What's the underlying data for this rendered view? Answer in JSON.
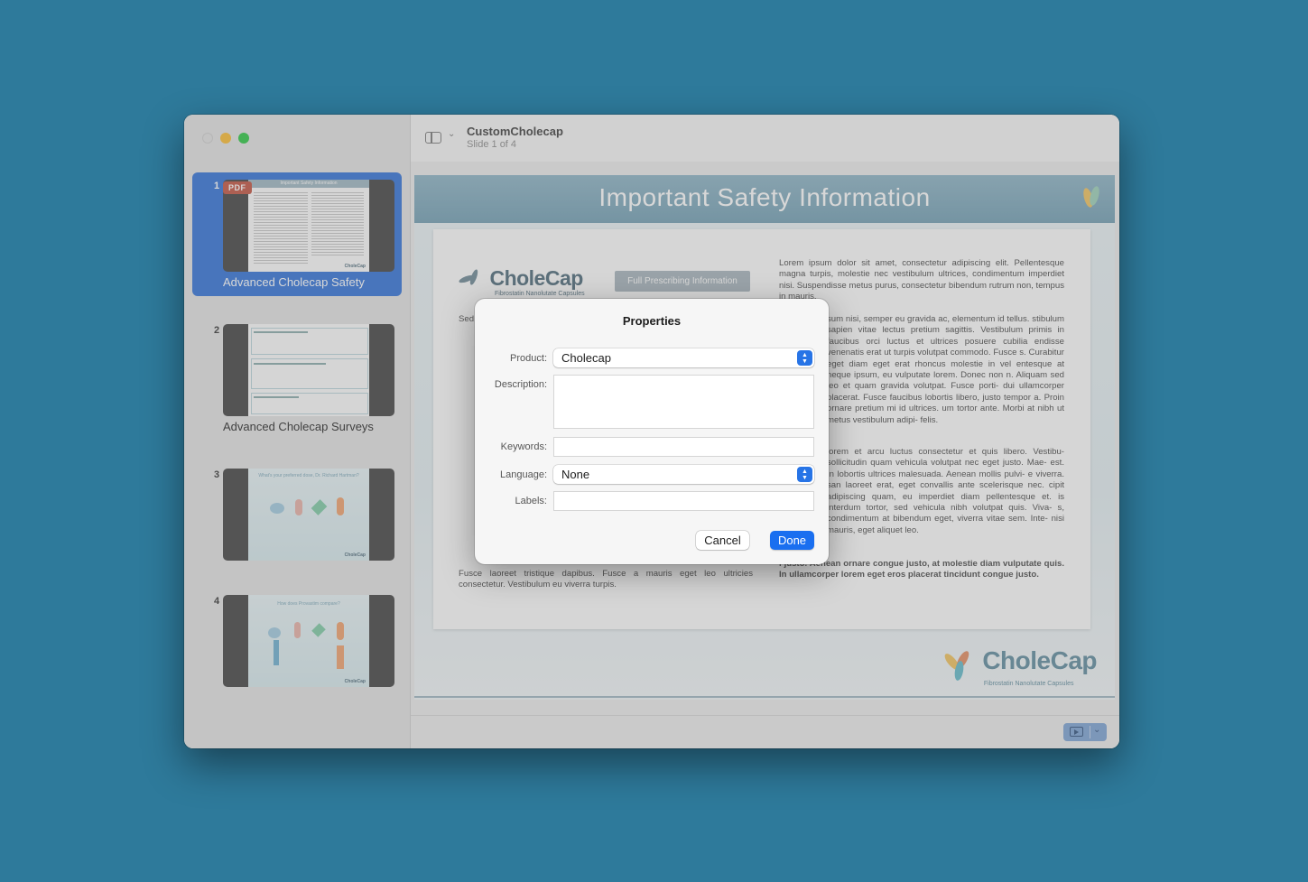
{
  "window": {
    "title": "CustomCholecap",
    "subtitle": "Slide 1 of 4"
  },
  "sidebar": {
    "slides": [
      {
        "number": "1",
        "label": "Advanced Cholecap Safety",
        "badge": "PDF",
        "thumb_title": "Important Safety Information"
      },
      {
        "number": "2",
        "label": "Advanced Cholecap Surveys"
      },
      {
        "number": "3",
        "label": "",
        "thumb_title": "What's your preferred dose, Dr. Richard Hartman?"
      },
      {
        "number": "4",
        "label": "",
        "thumb_title": "How does Provastim compare?"
      }
    ]
  },
  "slide": {
    "banner_title": "Important Safety Information",
    "logo_name": "CholeCap",
    "logo_tagline": "Fibrostatin Nanolutate Capsules",
    "prescribing_button": "Full Prescribing Information",
    "left_col_intro": "Sed",
    "left_col_bottom": "Fusce laoreet tristique dapibus. Fusce a mauris eget leo ultricies consectetur. Vestibulum eu viverra turpis.",
    "right_col_p1": "Lorem ipsum dolor sit amet, consectetur adipiscing elit. Pellentesque magna turpis, molestie nec vestibulum ultrices, condimentum imperdiet nisi. Suspendisse metus purus, consectetur bibendum rutrum non, tempus in mauris.",
    "right_col_p2": "sum nisi, semper eu gravida ac, elementum id tellus. stibulum sapien vitae lectus pretium sagittis. Vestibulum primis in faucibus orci luctus et ultrices posuere cubilia endisse venenatis erat ut turpis volutpat commodo. Fusce s. Curabitur eget diam eget erat rhoncus molestie in vel entesque at neque ipsum, eu vulputate lorem. Donec non n. Aliquam sed leo et quam gravida volutpat. Fusce porti- dui ullamcorper placerat. Fusce faucibus lobortis libero, justo tempor a. Proin ornare pretium mi id ultrices. um tortor ante. Morbi at nibh ut metus vestibulum adipi- felis.",
    "right_col_p3": "lorem et arcu luctus consectetur et quis libero. Vestibu- sollicitudin quam vehicula volutpat nec eget justo. Mae- est. In lobortis ultrices malesuada. Aenean mollis pulvi- e viverra. san laoreet erat, eget convallis ante scelerisque nec. cipit adipiscing quam, eu imperdiet diam pellentesque et. is interdum tortor, sed vehicula nibh volutpat quis. Viva- s, condimentum at bibendum eget, viverra vitae sem. Inte- nisi mauris, eget aliquet leo.",
    "right_col_p4": "i justo. Aenean ornare congue justo, at molestie diam vulputate quis. In ullamcorper lorem eget eros placerat tincidunt congue justo."
  },
  "dialog": {
    "title": "Properties",
    "fields": {
      "product_label": "Product:",
      "product_value": "Cholecap",
      "description_label": "Description:",
      "description_value": "",
      "keywords_label": "Keywords:",
      "keywords_value": "",
      "language_label": "Language:",
      "language_value": "None",
      "labels_label": "Labels:",
      "labels_value": ""
    },
    "cancel_label": "Cancel",
    "done_label": "Done"
  },
  "colors": {
    "desktop": "#2e7a9b",
    "accent": "#1a6ff0",
    "selection": "#2d6fd8",
    "pdf_badge": "#c2503d"
  },
  "icons": [
    "sidebar-toggle-icon",
    "chevron-down-icon",
    "present-icon",
    "stepper-icon"
  ]
}
